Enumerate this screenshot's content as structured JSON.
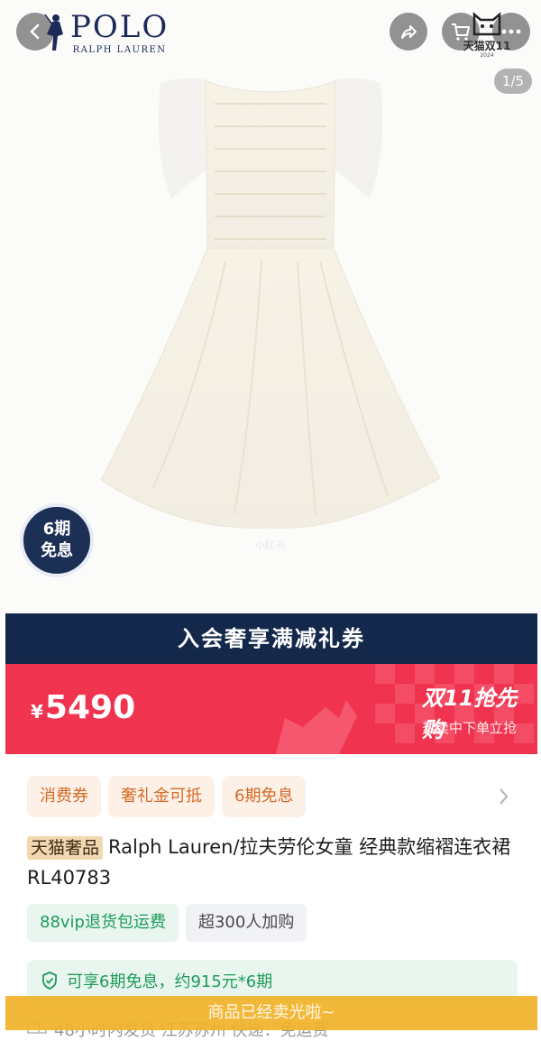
{
  "header": {
    "logo_text": "POLO",
    "logo_subtext": "RALPH LAUREN",
    "tmall_badge_text": "天猫双11",
    "tmall_badge_year": "2024",
    "image_counter": "1/5",
    "icons": [
      "back-icon",
      "share-icon",
      "cart-icon",
      "more-icon"
    ]
  },
  "gallery": {
    "watermark": "小红书",
    "installment_badge_line1": "6期",
    "installment_badge_line2": "免息"
  },
  "member_banner": "入会奢享满减礼券",
  "price": {
    "currency": "¥",
    "value": "5490",
    "promo_title": "双11抢先购",
    "promo_subtitle": "热卖中下单立抢"
  },
  "tags": [
    "消费券",
    "奢礼金可抵",
    "6期免息"
  ],
  "product": {
    "brand_tag": "天猫奢品",
    "title": "Ralph Lauren/拉夫劳伦女童 经典款缩褶连衣裙RL40783"
  },
  "chips": {
    "vip": "88vip退货包运费",
    "popularity": "超300人加购"
  },
  "finance": {
    "text": "可享6期免息，约915元*6期"
  },
  "shipping": {
    "text": "48小时内发货  江苏苏州  快递：免运费"
  },
  "sold_out": "商品已经卖光啦~",
  "colors": {
    "navy": "#13284a",
    "promo_red": "#f0334f",
    "tag_orange": "#d56a28",
    "green": "#1e9a5c",
    "soldout_yellow": "#f0b228"
  }
}
